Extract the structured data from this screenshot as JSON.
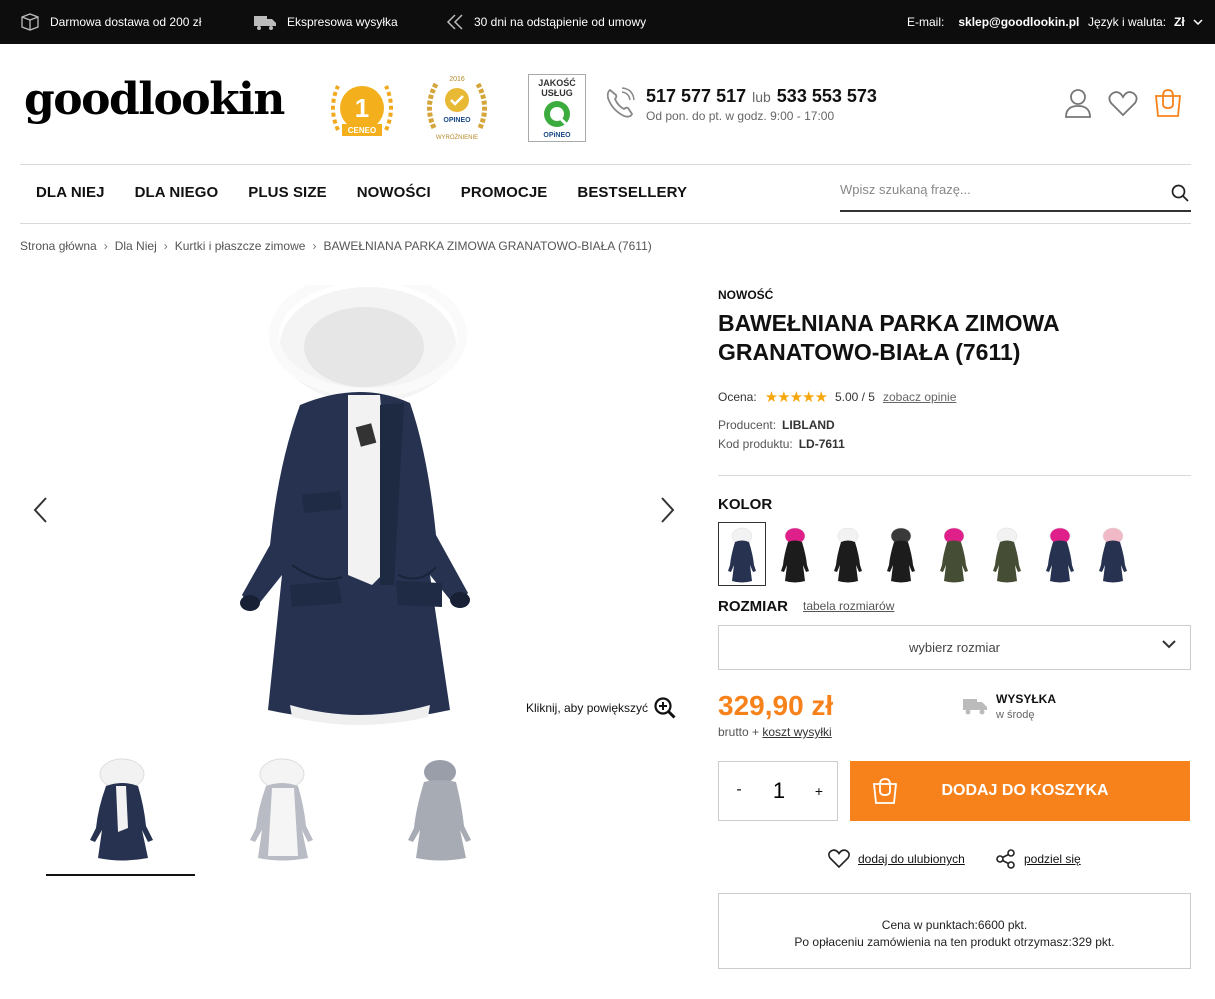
{
  "topbar": {
    "free_shipping": "Darmowa dostawa od 200 zł",
    "express": "Ekspresowa wysyłka",
    "returns": "30 dni na odstąpienie od umowy",
    "email_label": "E-mail:",
    "email_value": "sklep@goodlookin.pl",
    "currency_label": "Język i waluta:",
    "currency_value": "Zł"
  },
  "header": {
    "logo": "goodlookin",
    "badges": {
      "ceneo_number": "1",
      "ceneo_text": "CENEO",
      "opineo_year": "2016",
      "opineo_label": "OPINEO",
      "opineo_text": "WYRÓŻNIENIE",
      "jakosc_line1": "JAKOŚĆ",
      "jakosc_line2": "USŁUG",
      "jakosc_brand": "OPiNEO"
    },
    "phone1": "517 577 517",
    "phone_or": "lub",
    "phone2": "533 553 573",
    "hours": "Od pon. do pt. w godz. 9:00 - 17:00"
  },
  "nav": {
    "items": [
      "DLA NIEJ",
      "DLA NIEGO",
      "PLUS SIZE",
      "NOWOŚCI",
      "PROMOCJE",
      "BESTSELLERY"
    ],
    "search_placeholder": "Wpisz szukaną frazę..."
  },
  "breadcrumb": [
    "Strona główna",
    "Dla Niej",
    "Kurtki i płaszcze zimowe",
    "BAWEŁNIANA PARKA ZIMOWA GRANATOWO-BIAŁA (7611)"
  ],
  "gallery": {
    "zoom_text": "Kliknij, aby powiększyć"
  },
  "product": {
    "badge": "NOWOŚĆ",
    "title": "BAWEŁNIANA PARKA ZIMOWA GRANATOWO-BIAŁA (7611)",
    "rating_label": "Ocena:",
    "rating_stars": "★★★★★",
    "rating_value": "5.00 / 5",
    "rating_link": "zobacz opinie",
    "producer_label": "Producent:",
    "producer": "LIBLAND",
    "code_label": "Kod produktu:",
    "code": "LD-7611",
    "color_label": "KOLOR",
    "colors": [
      {
        "body": "#26324f",
        "fur": "#f2f2f2"
      },
      {
        "body": "#1c1c1c",
        "fur": "#e0208a"
      },
      {
        "body": "#1c1c1c",
        "fur": "#f2f2f2"
      },
      {
        "body": "#1c1c1c",
        "fur": "#3a3a3a"
      },
      {
        "body": "#464d35",
        "fur": "#e0208a"
      },
      {
        "body": "#464d35",
        "fur": "#f2f2f2"
      },
      {
        "body": "#26324f",
        "fur": "#e0208a"
      },
      {
        "body": "#26324f",
        "fur": "#f1b8c6"
      }
    ],
    "size_label": "ROZMIAR",
    "size_table_link": "tabela rozmiarów",
    "size_select": "wybierz rozmiar",
    "price": "329,90 zł",
    "price_sub": "brutto +",
    "shipping_cost_link": "koszt wysyłki",
    "shipping_title": "WYSYŁKA",
    "shipping_day": "w środę",
    "qty_minus": "-",
    "qty_value": "1",
    "qty_plus": "+",
    "add_to_cart": "DODAJ DO KOSZYKA",
    "favorite": "dodaj do ulubionych",
    "share": "podziel się",
    "points_line1": "Cena w punktach:6600 pkt.",
    "points_line2": "Po opłaceniu zamówienia na ten produkt otrzymasz:329 pkt."
  },
  "colors": {
    "accent": "#f7821b",
    "topbar_bg": "#0d0d0d",
    "star": "#f6a70b",
    "coat_navy": "#26324f"
  }
}
